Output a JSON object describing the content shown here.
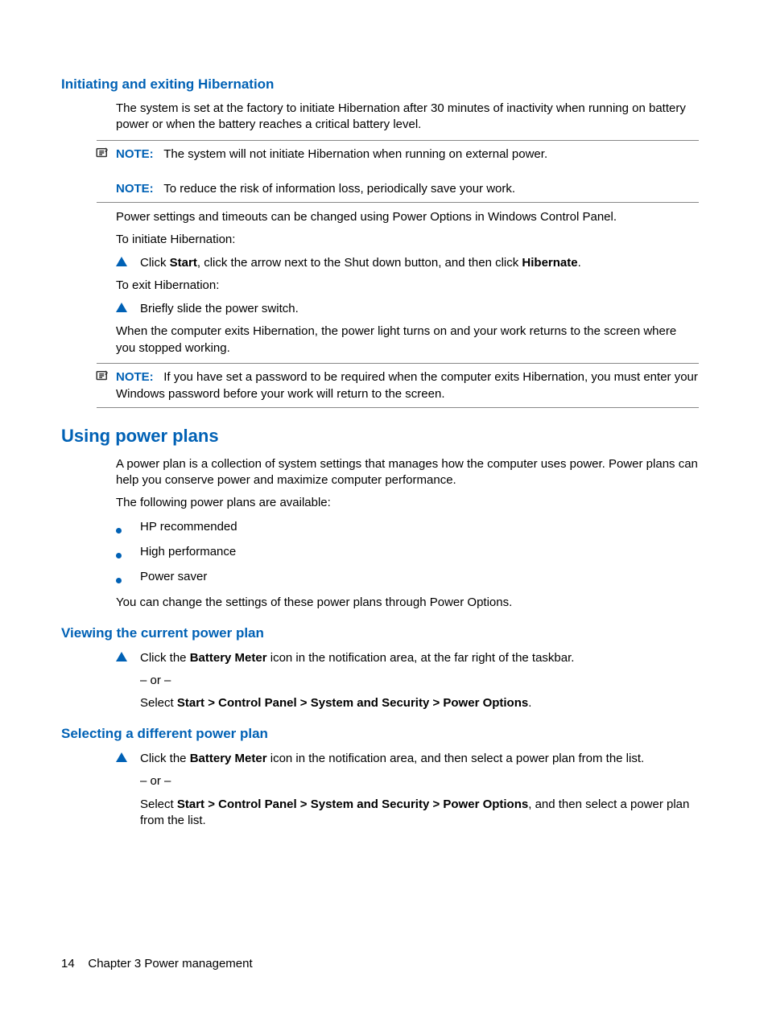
{
  "sec1": {
    "title": "Initiating and exiting Hibernation",
    "intro": "The system is set at the factory to initiate Hibernation after 30 minutes of inactivity when running on battery power or when the battery reaches a critical battery level.",
    "note1_label": "NOTE:",
    "note1": "The system will not initiate Hibernation when running on external power.",
    "note2_label": "NOTE:",
    "note2": "To reduce the risk of information loss, periodically save your work.",
    "p2": "Power settings and timeouts can be changed using Power Options in Windows Control Panel.",
    "p3": "To initiate Hibernation:",
    "step1_a": "Click ",
    "step1_b": "Start",
    "step1_c": ", click the arrow next to the Shut down button, and then click ",
    "step1_d": "Hibernate",
    "step1_e": ".",
    "p4": "To exit Hibernation:",
    "step2": "Briefly slide the power switch.",
    "p5": "When the computer exits Hibernation, the power light turns on and your work returns to the screen where you stopped working.",
    "note3_label": "NOTE:",
    "note3": "If you have set a password to be required when the computer exits Hibernation, you must enter your Windows password before your work will return to the screen."
  },
  "sec2": {
    "title": "Using power plans",
    "p1": "A power plan is a collection of system settings that manages how the computer uses power. Power plans can help you conserve power and maximize computer performance.",
    "p2": "The following power plans are available:",
    "b1": "HP recommended",
    "b2": "High performance",
    "b3": "Power saver",
    "p3": "You can change the settings of these power plans through Power Options."
  },
  "sec3": {
    "title": "Viewing the current power plan",
    "step1_a": "Click the ",
    "step1_b": "Battery Meter",
    "step1_c": " icon in the notification area, at the far right of the taskbar.",
    "or": "– or –",
    "sel_a": "Select ",
    "sel_b": "Start > Control Panel > System and Security  > Power Options",
    "sel_c": "."
  },
  "sec4": {
    "title": "Selecting a different power plan",
    "step1_a": "Click the ",
    "step1_b": "Battery Meter",
    "step1_c": " icon in the notification area, and then select a power plan from the list.",
    "or": "– or –",
    "sel_a": "Select ",
    "sel_b": "Start > Control Panel > System and Security > Power Options",
    "sel_c": ", and then select a power plan from the list."
  },
  "footer": {
    "page": "14",
    "chapter": "Chapter 3   Power management"
  }
}
